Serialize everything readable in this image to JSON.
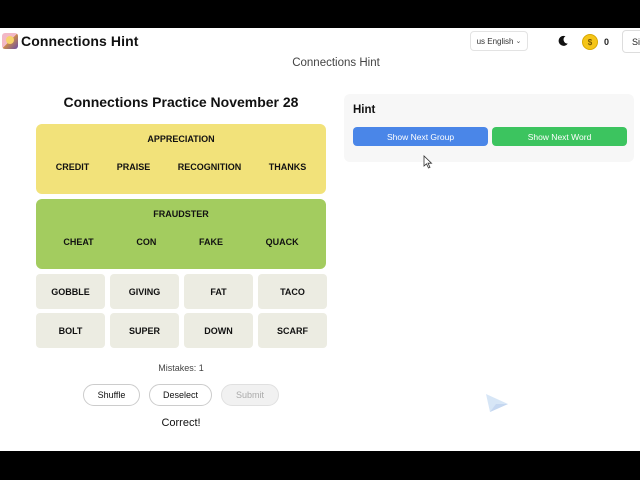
{
  "header": {
    "brand": "Connections Hint",
    "language": "us English",
    "coins": "0",
    "signin": "Si"
  },
  "subtitle": "Connections Hint",
  "game": {
    "title": "Connections Practice November 28",
    "solved": [
      {
        "category": "APPRECIATION",
        "words": [
          "CREDIT",
          "PRAISE",
          "RECOGNITION",
          "THANKS"
        ],
        "color": "#f2e27a"
      },
      {
        "category": "FRAUDSTER",
        "words": [
          "CHEAT",
          "CON",
          "FAKE",
          "QUACK"
        ],
        "color": "#a3cc5f"
      }
    ],
    "tiles": [
      "GOBBLE",
      "GIVING",
      "FAT",
      "TACO",
      "BOLT",
      "SUPER",
      "DOWN",
      "SCARF"
    ],
    "mistakes": "Mistakes: 1",
    "buttons": {
      "shuffle": "Shuffle",
      "deselect": "Deselect",
      "submit": "Submit"
    },
    "result": "Correct!"
  },
  "hint": {
    "title": "Hint",
    "next_group": "Show Next Group",
    "next_word": "Show Next Word"
  },
  "icons": {
    "logo": "logo-icon",
    "moon": "moon-icon",
    "coin": "coin-icon",
    "chevron": "chevron-down-icon",
    "cursor": "cursor-icon"
  },
  "colors": {
    "yellow_group": "#f2e27a",
    "green_group": "#a3cc5f",
    "tile": "#ecece2",
    "hint_blue": "#4a86e8",
    "hint_green": "#3cc45f"
  }
}
